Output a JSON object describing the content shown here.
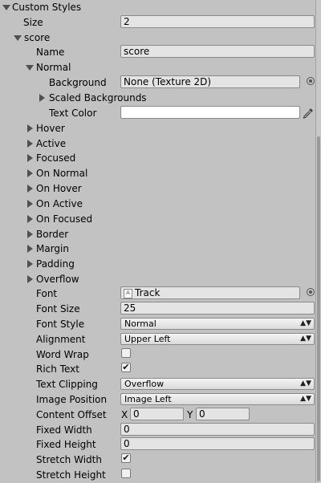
{
  "custom_styles": {
    "label": "Custom Styles"
  },
  "size": {
    "label": "Size",
    "value": "2"
  },
  "score": {
    "label": "score"
  },
  "name": {
    "label": "Name",
    "value": "score"
  },
  "normal": {
    "label": "Normal"
  },
  "background": {
    "label": "Background",
    "value": "None (Texture 2D)"
  },
  "scaled_backgrounds": {
    "label": "Scaled Backgrounds"
  },
  "text_color": {
    "label": "Text Color",
    "value": "#ffffff"
  },
  "states": [
    "Hover",
    "Active",
    "Focused",
    "On Normal",
    "On Hover",
    "On Active",
    "On Focused",
    "Border",
    "Margin",
    "Padding",
    "Overflow"
  ],
  "font": {
    "label": "Font",
    "value": "Track"
  },
  "font_size": {
    "label": "Font Size",
    "value": "25"
  },
  "font_style": {
    "label": "Font Style",
    "value": "Normal"
  },
  "alignment": {
    "label": "Alignment",
    "value": "Upper Left"
  },
  "word_wrap": {
    "label": "Word Wrap",
    "checked": false
  },
  "rich_text": {
    "label": "Rich Text",
    "checked": true
  },
  "text_clipping": {
    "label": "Text Clipping",
    "value": "Overflow"
  },
  "image_position": {
    "label": "Image Position",
    "value": "Image Left"
  },
  "content_offset": {
    "label": "Content Offset",
    "x_label": "X",
    "x": "0",
    "y_label": "Y",
    "y": "0"
  },
  "fixed_width": {
    "label": "Fixed Width",
    "value": "0"
  },
  "fixed_height": {
    "label": "Fixed Height",
    "value": "0"
  },
  "stretch_width": {
    "label": "Stretch Width",
    "checked": true
  },
  "stretch_height": {
    "label": "Stretch Height",
    "checked": false
  }
}
